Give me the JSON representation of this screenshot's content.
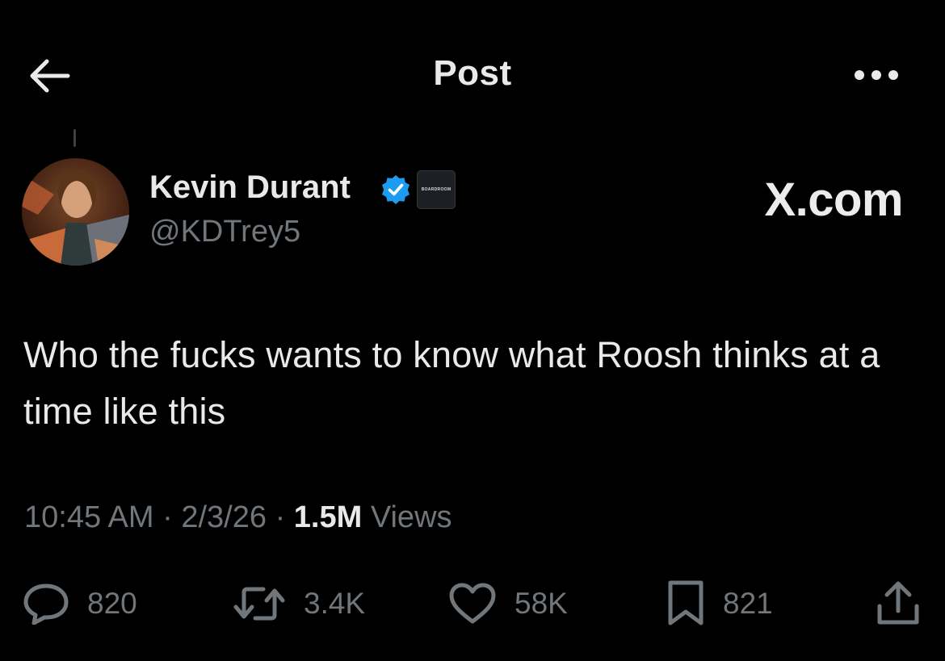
{
  "header": {
    "title": "Post",
    "back_icon": "arrow-left-icon",
    "more_icon": "ellipsis-icon"
  },
  "post": {
    "author": {
      "name": "Kevin Durant",
      "handle": "@KDTrey5",
      "verified": true,
      "affiliate_badge_text": "BOARDROOM"
    },
    "watermark": "X.com",
    "text": "Who the fucks wants to know what Roosh thinks at a time like this",
    "meta": {
      "time": "10:45 AM",
      "separator": "·",
      "date": "2/3/26",
      "views_count": "1.5M",
      "views_label": "Views"
    },
    "actions": {
      "replies": "820",
      "reposts": "3.4K",
      "likes": "58K",
      "bookmarks": "821"
    }
  },
  "colors": {
    "background": "#000000",
    "primary_text": "#e7e9ea",
    "secondary_text": "#71767b",
    "verified_blue": "#1d9bf0"
  }
}
